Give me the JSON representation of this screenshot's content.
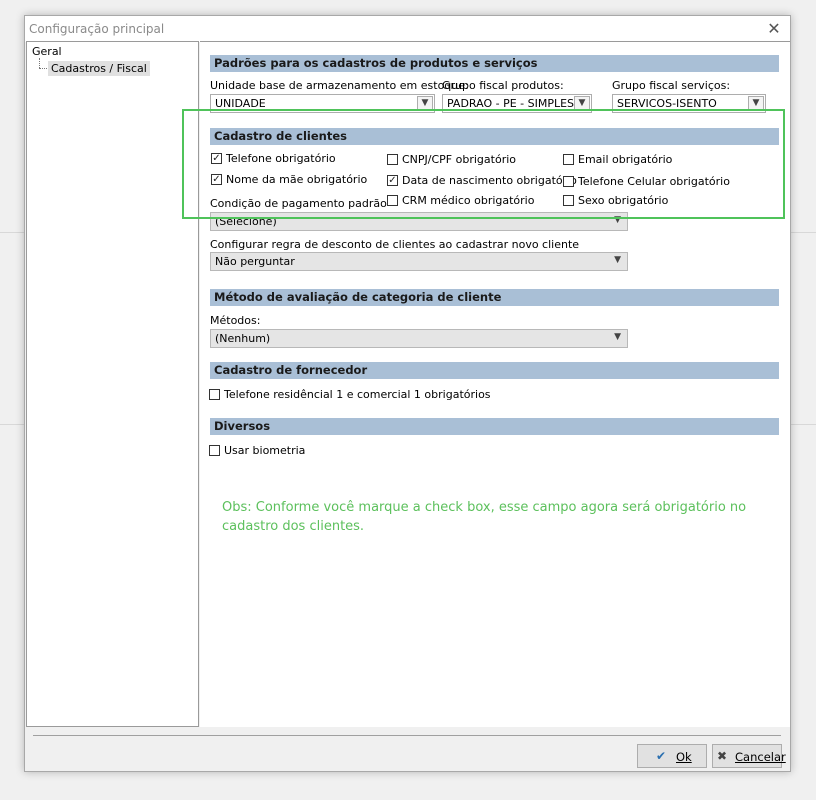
{
  "window": {
    "title": "Configuração principal",
    "close_glyph": "✕"
  },
  "tree": {
    "root": "Geral",
    "child": "Cadastros / Fiscal"
  },
  "sections": {
    "padroes": "Padrões para os cadastros de produtos e serviços",
    "clientes": "Cadastro de clientes",
    "metodo": "Método de avaliação de categoria de cliente",
    "fornecedor": "Cadastro de fornecedor",
    "diversos": "Diversos"
  },
  "padroes": {
    "unidade_label": "Unidade base de armazenamento em estoque:",
    "unidade_value": "UNIDADE",
    "grupo_prod_label": "Grupo fiscal produtos:",
    "grupo_prod_value": "PADRAO - PE - SIMPLES",
    "grupo_serv_label": "Grupo fiscal serviços:",
    "grupo_serv_value": "SERVICOS-ISENTO"
  },
  "clientes": {
    "checks": [
      {
        "label": "Telefone obrigatório",
        "checked": true
      },
      {
        "label": "Nome da mãe obrigatório",
        "checked": true
      },
      {
        "label": "CNPJ/CPF obrigatório",
        "checked": false
      },
      {
        "label": "Data de nascimento obrigatório",
        "checked": true
      },
      {
        "label": "CRM médico obrigatório",
        "checked": false
      },
      {
        "label": "Email obrigatório",
        "checked": false
      },
      {
        "label": "Telefone Celular obrigatório",
        "checked": false
      },
      {
        "label": "Sexo obrigatório",
        "checked": false
      }
    ],
    "condicao_label": "Condição de pagamento padrão",
    "condicao_value": "(Selecione)",
    "desconto_label": "Configurar regra de desconto de clientes ao cadastrar novo cliente",
    "desconto_value": "Não perguntar"
  },
  "metodo": {
    "label": "Métodos:",
    "value": "(Nenhum)"
  },
  "fornecedor": {
    "check_label": "Telefone residêncial 1 e comercial 1 obrigatórios",
    "checked": false
  },
  "diversos": {
    "check_label": "Usar biometria",
    "checked": false
  },
  "note": "Obs: Conforme você marque a check box, esse campo agora será obrigatório no cadastro dos clientes.",
  "buttons": {
    "ok": "Ok",
    "cancel": "Cancelar"
  },
  "colors": {
    "section_header": "#a9bfd6",
    "highlight": "#4fc35a",
    "note_text": "#5cc05c"
  },
  "icons": {
    "ok": "check-icon",
    "cancel": "x-icon",
    "dropdown": "chevron-down-icon"
  }
}
